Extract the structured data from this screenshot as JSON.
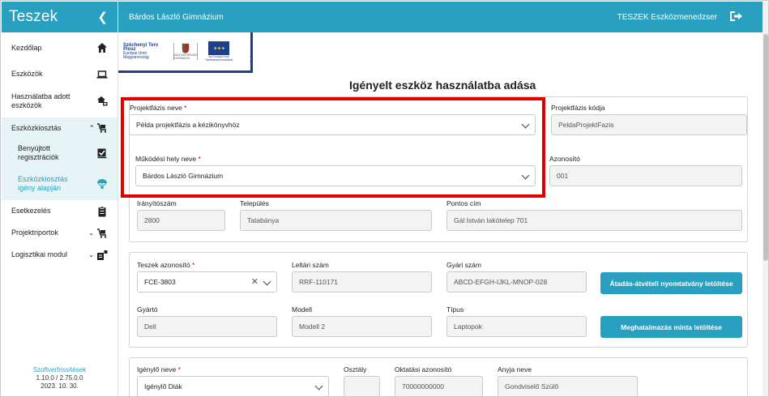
{
  "sidebar": {
    "brand": "Teszek",
    "items": [
      {
        "label": "Kezdőlap",
        "icon": "home-icon"
      },
      {
        "label": "Eszközök",
        "icon": "laptop-icon"
      },
      {
        "label": "Használatba adott eszközök",
        "icon": "handover-icon"
      },
      {
        "label": "Eszközkiosztás",
        "icon": "cart-icon"
      },
      {
        "label": "Benyújtott regisztrációk",
        "icon": "checkbox-icon"
      },
      {
        "label": "Eszközkiosztás igény alapján",
        "icon": "parachute-icon"
      },
      {
        "label": "Esetkezelés",
        "icon": "clipboard-icon"
      },
      {
        "label": "Projektriportok",
        "icon": "report-icon"
      },
      {
        "label": "Logisztikai modul",
        "icon": "logistics-icon"
      }
    ],
    "footer": {
      "link": "Szoftverfrissítések",
      "version": "1.10.0 / 2.75.0.0",
      "date": "2023. 10. 30."
    }
  },
  "topbar": {
    "school": "Bárdos László Gimnázium",
    "app": "TESZEK Eszközmenedzser"
  },
  "logos": {
    "szechenyi_title": "Széchenyi Terv",
    "szechenyi_plus": "Plusz",
    "szechenyi_sub": "Európai Unió Magyarország",
    "hu_text": "MAGYARORSZÁG KORMÁNYA",
    "eu_text": "Az Európai Unió Társfinanszírozásával"
  },
  "page_title": "Igényelt eszköz használatba adása",
  "section1": {
    "projektfazis_label": "Projektfázis neve",
    "projektfazis_value": "Példa projektfázis a kézikönyvhöz",
    "projektfazis_kod_label": "Projektfázis kódja",
    "projektfazis_kod_value": "PeldaProjektFazis",
    "mukodesi_label": "Működési hely neve",
    "mukodesi_value": "Bárdos László Gimnázium",
    "azonosito_label": "Azonosító",
    "azonosito_value": "001",
    "iranyitoszam_label": "Irányítószám",
    "iranyitoszam_value": "2800",
    "telepules_label": "Település",
    "telepules_value": "Tatabánya",
    "cim_label": "Pontos cím",
    "cim_value": "Gál István lakótelep 701"
  },
  "section2": {
    "teszek_label": "Teszek azonosító",
    "teszek_value": "FCE-3803",
    "leltari_label": "Leltári szám",
    "leltari_value": "RRF-110171",
    "gyari_label": "Gyári szám",
    "gyari_value": "ABCD-EFGH-IJKL-MNOP-028",
    "btn_atadas": "Átadás-átvételi nyomtatvány letöltése",
    "gyarto_label": "Gyártó",
    "gyarto_value": "Dell",
    "modell_label": "Modell",
    "modell_value": "Modell 2",
    "tipus_label": "Típus",
    "tipus_value": "Laptopok",
    "btn_meghatalmazas": "Meghatalmazás minta letöltése"
  },
  "section3": {
    "igenylo_label": "Igénylő neve",
    "igenylo_value": "Igénylő Diák",
    "osztaly_label": "Osztály",
    "osztaly_value": "",
    "oktatasi_label": "Oktatási azonosító",
    "oktatasi_value": "70000000000",
    "anyja_label": "Anyja neve",
    "anyja_value": "Gondviselő Szülő"
  },
  "colors": {
    "accent": "#2aa0c0",
    "highlight": "#e00000",
    "sidebar_active": "#e6f4f8"
  }
}
